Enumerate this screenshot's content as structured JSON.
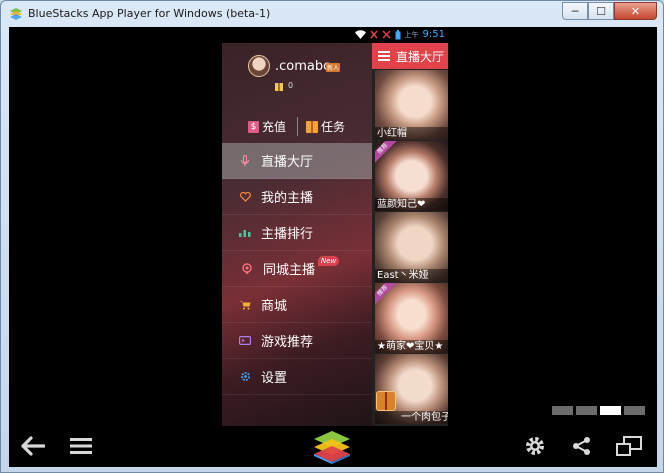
{
  "window": {
    "title": "BlueStacks App Player for Windows (beta-1)",
    "buttons": {
      "minimize": "─",
      "maximize": "☐",
      "close": "✕"
    }
  },
  "statusbar": {
    "time_label": "上午",
    "time": "9:51"
  },
  "drawer": {
    "username": ".comabc",
    "level_badge": "新人",
    "coins": "0",
    "charge_label": "充值",
    "task_label": "任务",
    "menu": [
      {
        "label": "直播大厅",
        "icon": "microphone-icon",
        "color": "#ff8fa3",
        "active": true
      },
      {
        "label": "我的主播",
        "icon": "heart-icon",
        "color": "#ff8a3d",
        "active": false
      },
      {
        "label": "主播排行",
        "icon": "bar-chart-icon",
        "color": "#4fc3a1",
        "active": false
      },
      {
        "label": "同城主播",
        "icon": "location-icon",
        "color": "#ff6f7f",
        "active": false,
        "badge": "New"
      },
      {
        "label": "商城",
        "icon": "cart-icon",
        "color": "#f2b134",
        "active": false
      },
      {
        "label": "游戏推荐",
        "icon": "gamepad-icon",
        "color": "#b07cf0",
        "active": false
      },
      {
        "label": "设置",
        "icon": "gear-icon",
        "color": "#3fa0f5",
        "active": false
      }
    ]
  },
  "right_panel": {
    "title": "直播大厅",
    "streams": [
      {
        "name": "小红帽",
        "recommended": false
      },
      {
        "name": "蓝颜知己❤",
        "recommended": true
      },
      {
        "name": "East丶米娅",
        "recommended": false
      },
      {
        "name": "★萌家❤宝贝★",
        "recommended": true
      },
      {
        "name": "一个肉包子",
        "recommended": false
      }
    ],
    "recommended_label": "推荐"
  },
  "pager": {
    "count": 4,
    "active": 2
  },
  "colors": {
    "accent_red": "#e2434b",
    "time_blue": "#3fa9f5"
  }
}
